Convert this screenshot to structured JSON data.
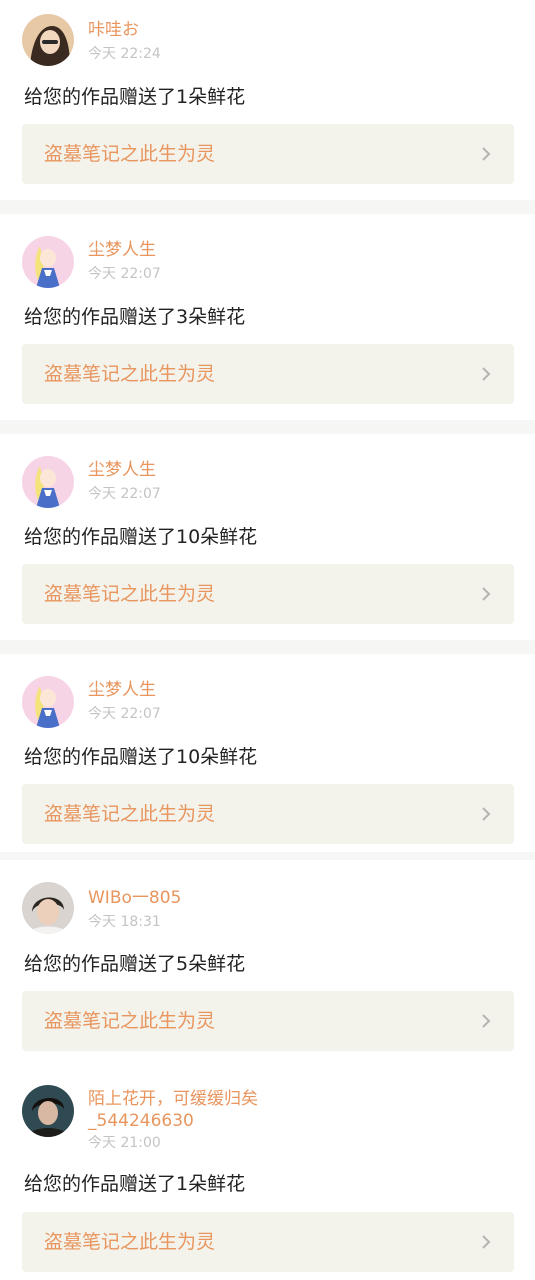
{
  "notifications": [
    {
      "user": "咔哇お",
      "time": "今天 22:24",
      "message": "给您的作品赠送了1朵鲜花",
      "work_title": "盗墓笔记之此生为灵",
      "avatar": "photo-girl-avatar"
    },
    {
      "user": "尘梦人生",
      "time": "今天 22:07",
      "message": "给您的作品赠送了3朵鲜花",
      "work_title": "盗墓笔记之此生为灵",
      "avatar": "anime-girl-avatar"
    },
    {
      "user": "尘梦人生",
      "time": "今天 22:07",
      "message": "给您的作品赠送了10朵鲜花",
      "work_title": "盗墓笔记之此生为灵",
      "avatar": "anime-girl-avatar"
    },
    {
      "user": "尘梦人生",
      "time": "今天 22:07",
      "message": "给您的作品赠送了10朵鲜花",
      "work_title": "盗墓笔记之此生为灵",
      "avatar": "anime-girl-avatar"
    },
    {
      "user": "WIBo一805",
      "time": "今天 18:31",
      "message": "给您的作品赠送了5朵鲜花",
      "work_title": "盗墓笔记之此生为灵",
      "avatar": "photo-boy-avatar"
    },
    {
      "user_line1": "陌上花开，可缓缓归矣",
      "user_line2": "_544246630",
      "time": "今天 21:00",
      "message": "给您的作品赠送了1朵鲜花",
      "work_title": "盗墓笔记之此生为灵",
      "avatar": "photo-boy-dark-avatar"
    }
  ],
  "colors": {
    "accent": "#e8955e",
    "time_gray": "#c4c4c4",
    "card_bg": "#f3f3ec",
    "separator": "#f6f6f4",
    "text": "#222222"
  },
  "icons": {
    "chevron": "chevron-right-icon"
  }
}
